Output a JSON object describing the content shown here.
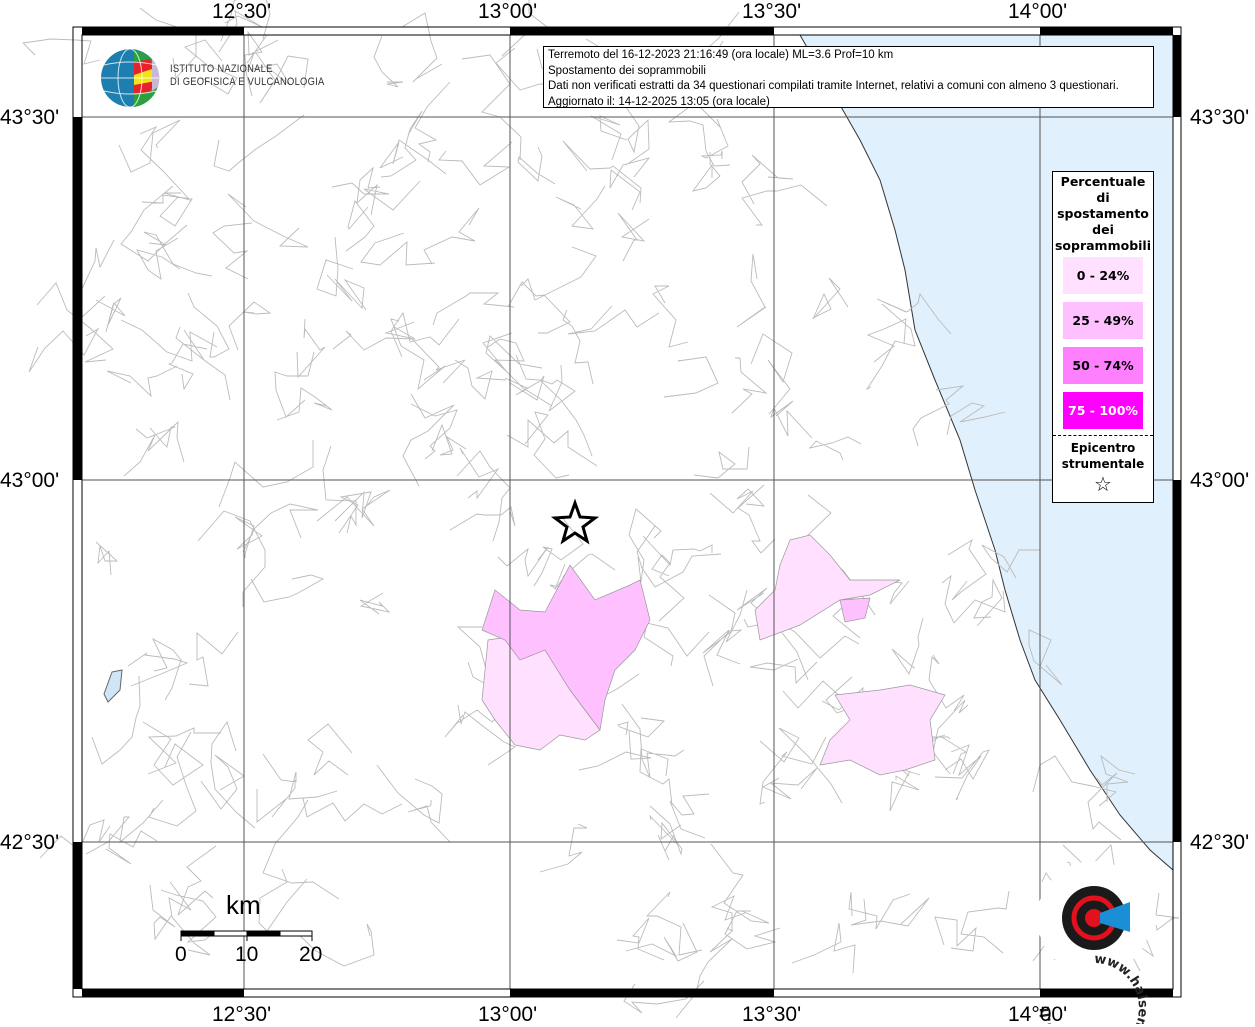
{
  "header": {
    "line1": "Terremoto del 16-12-2023 21:16:49 (ora locale) ML=3.6 Prof=10 km",
    "line2": "Spostamento dei soprammobili",
    "line3": "Dati non verificati estratti da 34 questionari compilati tramite Internet, relativi a comuni con almeno 3 questionari.",
    "line4": "Aggiornato il: 14-12-2025 13:05 (ora locale)"
  },
  "logo_ingv": {
    "line1": "ISTITUTO NAZIONALE",
    "line2": "DI GEOFISICA E VULCANOLOGIA"
  },
  "logo_hsit": {
    "text": "www.haisentitoilterremoto.it"
  },
  "axes": {
    "lon_labels": [
      "12°30'",
      "13°00'",
      "13°30'",
      "14°00'"
    ],
    "lat_labels": [
      "43°30'",
      "43°00'",
      "42°30'"
    ]
  },
  "legend": {
    "title": [
      "Percentuale",
      "di",
      "spostamento",
      "dei",
      "soprammobili"
    ],
    "classes": [
      {
        "label": "0 - 24%",
        "color": "#ffe0ff"
      },
      {
        "label": "25 - 49%",
        "color": "#ffc0ff"
      },
      {
        "label": "50 - 74%",
        "color": "#ff80ff"
      },
      {
        "label": "75 - 100%",
        "color": "#ff00ff"
      }
    ],
    "epicenter_label": [
      "Epicentro",
      "strumentale"
    ],
    "epicenter_symbol": "☆"
  },
  "scale": {
    "unit": "km",
    "ticks": [
      "0",
      "10",
      "20"
    ]
  },
  "colors": {
    "sea": "#e0f0fc",
    "boundaries": "#b8b8b8",
    "grid": "#555555"
  }
}
